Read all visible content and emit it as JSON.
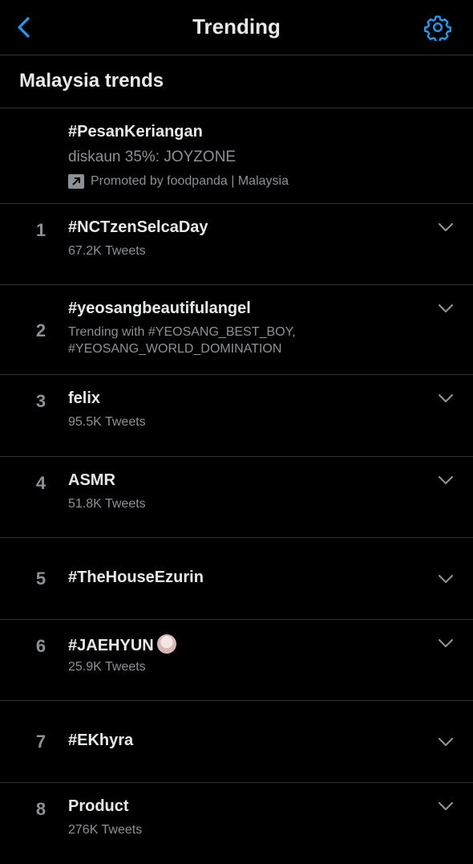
{
  "header": {
    "title": "Trending"
  },
  "section": {
    "title": "Malaysia trends"
  },
  "promoted": {
    "tag": "#PesanKeriangan",
    "description": "diskaun 35%: JOYZONE",
    "promoted_by": "Promoted by foodpanda | Malaysia"
  },
  "trends": [
    {
      "rank": "1",
      "name": "#NCTzenSelcaDay",
      "meta": "67.2K Tweets"
    },
    {
      "rank": "2",
      "name": "#yeosangbeautifulangel",
      "meta_line1": "Trending with #YEOSANG_BEST_BOY,",
      "meta_line2": "#YEOSANG_WORLD_DOMINATION"
    },
    {
      "rank": "3",
      "name": "felix",
      "meta": "95.5K Tweets"
    },
    {
      "rank": "4",
      "name": "ASMR",
      "meta": "51.8K Tweets"
    },
    {
      "rank": "5",
      "name": "#TheHouseEzurin"
    },
    {
      "rank": "6",
      "name": "#JAEHYUN",
      "meta": "25.9K Tweets"
    },
    {
      "rank": "7",
      "name": "#EKhyra"
    },
    {
      "rank": "8",
      "name": "Product",
      "meta": "276K Tweets"
    }
  ],
  "colors": {
    "accent": "#1d9bf0",
    "background": "#000000",
    "text": "#e7e9ea",
    "secondary": "#8b9196"
  }
}
